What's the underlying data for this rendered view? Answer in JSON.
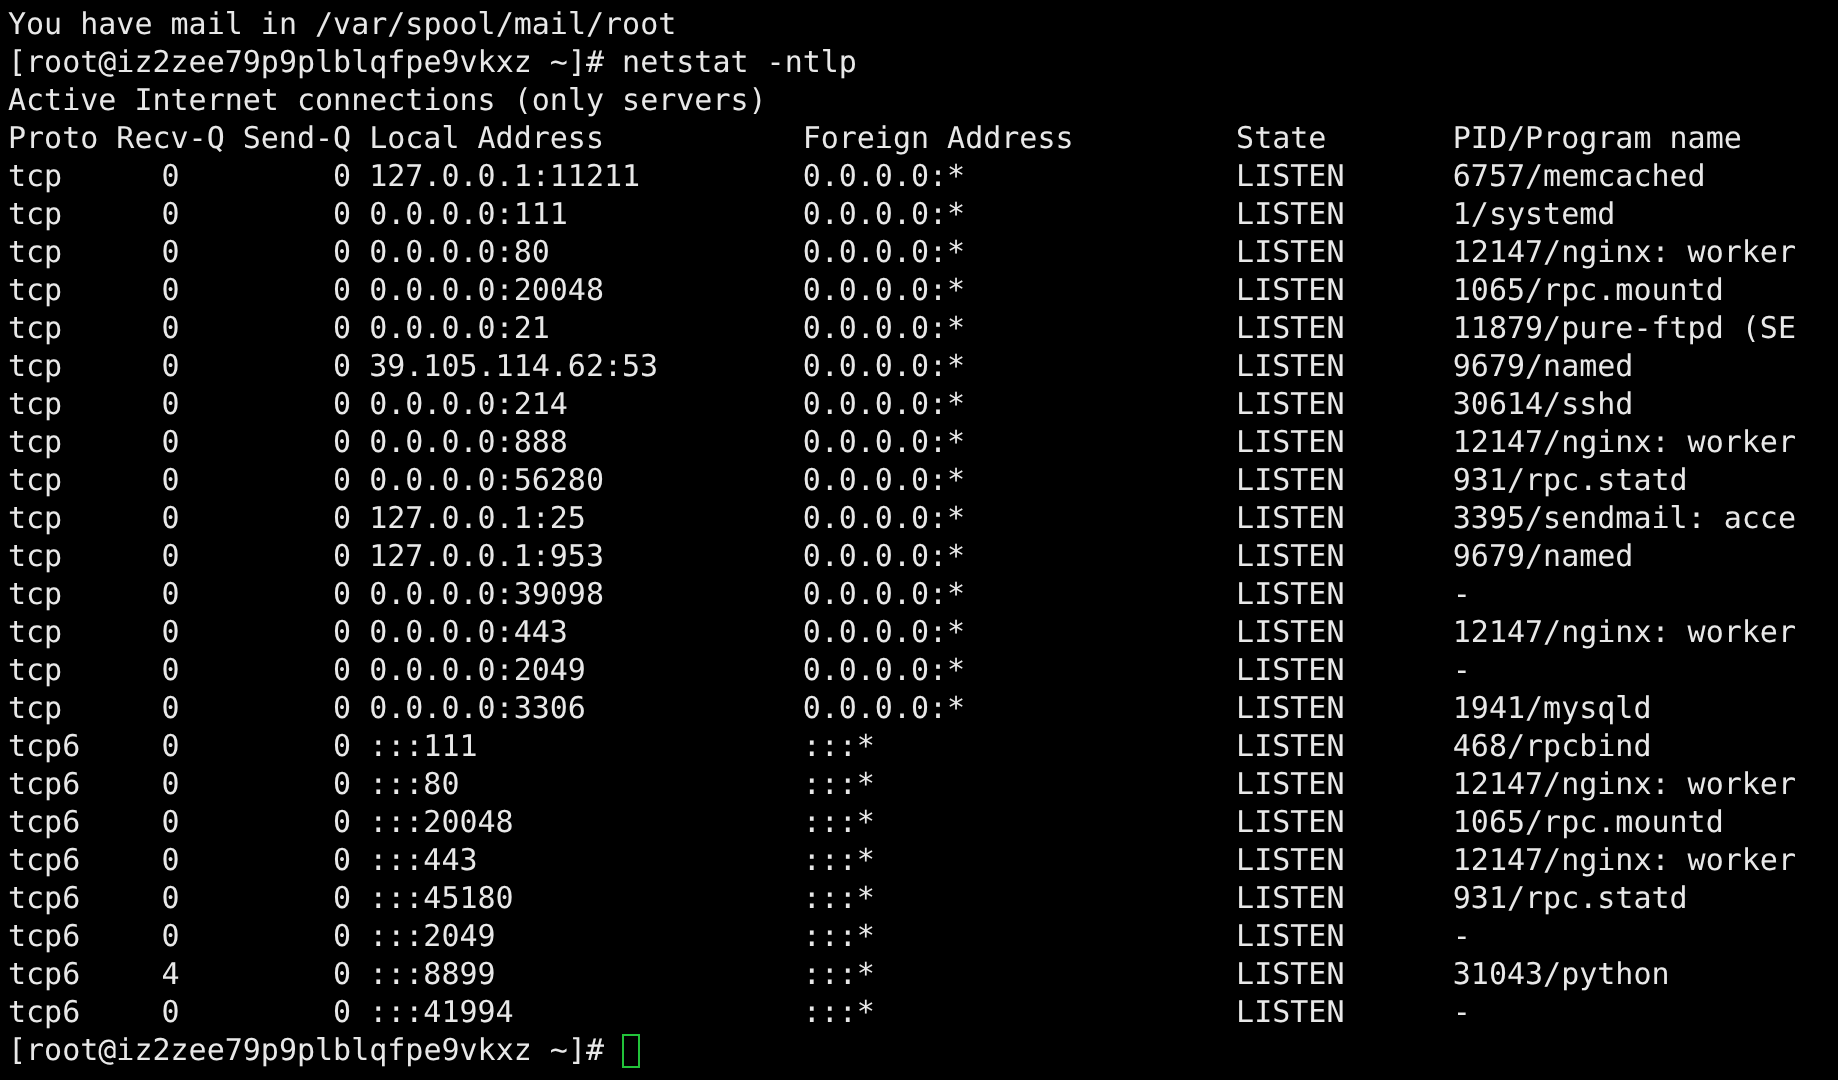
{
  "terminal": {
    "mail_notice": "You have mail in /var/spool/mail/root",
    "command": {
      "prompt": "[root@iz2zee79p9plblqfpe9vkxz ~]#",
      "text": "netstat -ntlp"
    },
    "info": "Active Internet connections (only servers)",
    "columns": [
      "Proto",
      "Recv-Q",
      "Send-Q",
      "Local Address",
      "Foreign Address",
      "State",
      "PID/Program name"
    ],
    "rows": [
      [
        "tcp",
        "0",
        "0",
        "127.0.0.1:11211",
        "0.0.0.0:*",
        "LISTEN",
        "6757/memcached"
      ],
      [
        "tcp",
        "0",
        "0",
        "0.0.0.0:111",
        "0.0.0.0:*",
        "LISTEN",
        "1/systemd"
      ],
      [
        "tcp",
        "0",
        "0",
        "0.0.0.0:80",
        "0.0.0.0:*",
        "LISTEN",
        "12147/nginx: worker"
      ],
      [
        "tcp",
        "0",
        "0",
        "0.0.0.0:20048",
        "0.0.0.0:*",
        "LISTEN",
        "1065/rpc.mountd"
      ],
      [
        "tcp",
        "0",
        "0",
        "0.0.0.0:21",
        "0.0.0.0:*",
        "LISTEN",
        "11879/pure-ftpd (SE"
      ],
      [
        "tcp",
        "0",
        "0",
        "39.105.114.62:53",
        "0.0.0.0:*",
        "LISTEN",
        "9679/named"
      ],
      [
        "tcp",
        "0",
        "0",
        "0.0.0.0:214",
        "0.0.0.0:*",
        "LISTEN",
        "30614/sshd"
      ],
      [
        "tcp",
        "0",
        "0",
        "0.0.0.0:888",
        "0.0.0.0:*",
        "LISTEN",
        "12147/nginx: worker"
      ],
      [
        "tcp",
        "0",
        "0",
        "0.0.0.0:56280",
        "0.0.0.0:*",
        "LISTEN",
        "931/rpc.statd"
      ],
      [
        "tcp",
        "0",
        "0",
        "127.0.0.1:25",
        "0.0.0.0:*",
        "LISTEN",
        "3395/sendmail: acce"
      ],
      [
        "tcp",
        "0",
        "0",
        "127.0.0.1:953",
        "0.0.0.0:*",
        "LISTEN",
        "9679/named"
      ],
      [
        "tcp",
        "0",
        "0",
        "0.0.0.0:39098",
        "0.0.0.0:*",
        "LISTEN",
        "-"
      ],
      [
        "tcp",
        "0",
        "0",
        "0.0.0.0:443",
        "0.0.0.0:*",
        "LISTEN",
        "12147/nginx: worker"
      ],
      [
        "tcp",
        "0",
        "0",
        "0.0.0.0:2049",
        "0.0.0.0:*",
        "LISTEN",
        "-"
      ],
      [
        "tcp",
        "0",
        "0",
        "0.0.0.0:3306",
        "0.0.0.0:*",
        "LISTEN",
        "1941/mysqld"
      ],
      [
        "tcp6",
        "0",
        "0",
        ":::111",
        ":::*",
        "LISTEN",
        "468/rpcbind"
      ],
      [
        "tcp6",
        "0",
        "0",
        ":::80",
        ":::*",
        "LISTEN",
        "12147/nginx: worker"
      ],
      [
        "tcp6",
        "0",
        "0",
        ":::20048",
        ":::*",
        "LISTEN",
        "1065/rpc.mountd"
      ],
      [
        "tcp6",
        "0",
        "0",
        ":::443",
        ":::*",
        "LISTEN",
        "12147/nginx: worker"
      ],
      [
        "tcp6",
        "0",
        "0",
        ":::45180",
        ":::*",
        "LISTEN",
        "931/rpc.statd"
      ],
      [
        "tcp6",
        "0",
        "0",
        ":::2049",
        ":::*",
        "LISTEN",
        "-"
      ],
      [
        "tcp6",
        "4",
        "0",
        ":::8899",
        ":::*",
        "LISTEN",
        "31043/python"
      ],
      [
        "tcp6",
        "0",
        "0",
        ":::41994",
        ":::*",
        "LISTEN",
        "-"
      ]
    ],
    "final_prompt": "[root@iz2zee79p9plblqfpe9vkxz ~]#"
  }
}
